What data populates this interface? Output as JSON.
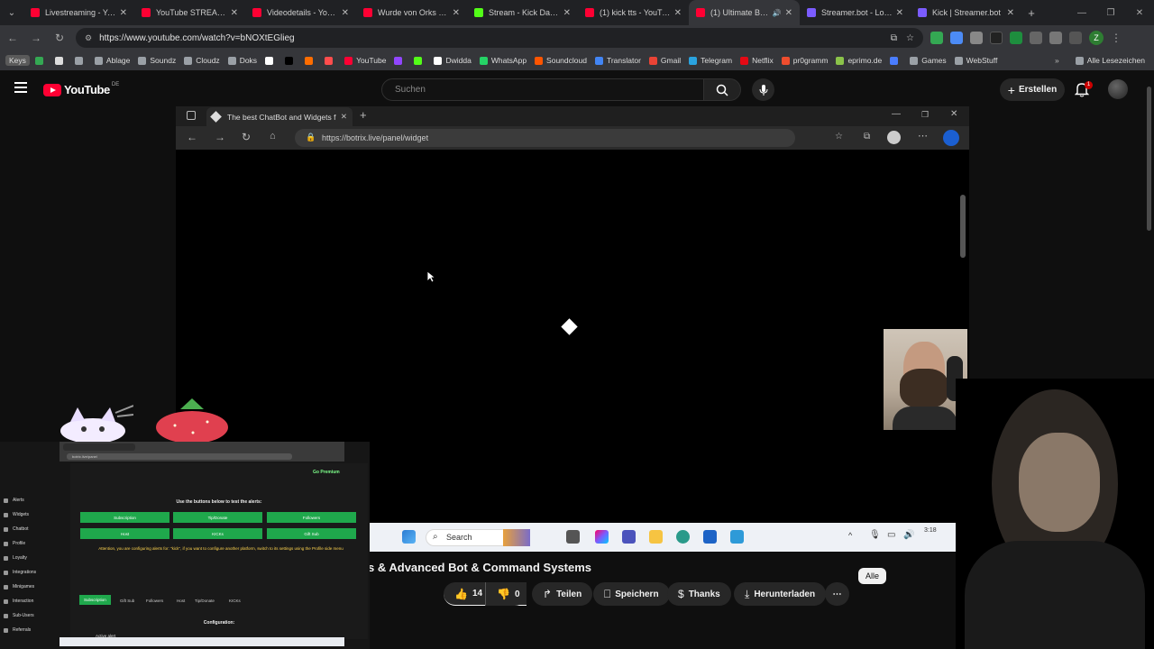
{
  "chrome": {
    "tabs": [
      {
        "title": "Livestreaming - YouT",
        "color": "#ff0033",
        "active": false
      },
      {
        "title": "YouTube STREAM Elh",
        "color": "#ff0033",
        "active": false
      },
      {
        "title": "Videodetails - YouTu",
        "color": "#ff0033",
        "active": false
      },
      {
        "title": "Wurde von Orks aus",
        "color": "#ff0033",
        "active": false
      },
      {
        "title": "Stream - Kick Dashbo",
        "color": "#53fc18",
        "active": false
      },
      {
        "title": "(1) kick tts - YouTube",
        "color": "#ff0033",
        "active": false
      },
      {
        "title": "(1) Ultimate BotR",
        "color": "#ff0033",
        "active": true
      },
      {
        "title": "Streamer.bot - Logge",
        "color": "#7b5cff",
        "active": false
      },
      {
        "title": "Kick | Streamer.bot",
        "color": "#7b5cff",
        "active": false
      }
    ],
    "url": "https://www.youtube.com/watch?v=bNOXtEGlieg",
    "bookmarks": [
      {
        "label": "Ablage",
        "color": "#9aa0a6"
      },
      {
        "label": "Soundz",
        "color": "#9aa0a6"
      },
      {
        "label": "Cloudz",
        "color": "#9aa0a6"
      },
      {
        "label": "Doks",
        "color": "#9aa0a6"
      },
      {
        "label": "",
        "color": "#ffffff"
      },
      {
        "label": "",
        "color": "#000000"
      },
      {
        "label": "",
        "color": "#ff6d00"
      },
      {
        "label": "",
        "color": "#ff4d4d"
      },
      {
        "label": "YouTube",
        "color": "#ff0033"
      },
      {
        "label": "",
        "color": "#9146ff"
      },
      {
        "label": "",
        "color": "#53fc18"
      },
      {
        "label": "Dwidda",
        "color": "#ffffff"
      },
      {
        "label": "WhatsApp",
        "color": "#25d366"
      },
      {
        "label": "Soundcloud",
        "color": "#ff5500"
      },
      {
        "label": "Translator",
        "color": "#4285f4"
      },
      {
        "label": "Gmail",
        "color": "#ea4335"
      },
      {
        "label": "Telegram",
        "color": "#2aa3df"
      },
      {
        "label": "Netflix",
        "color": "#e50914"
      },
      {
        "label": "pr0gramm",
        "color": "#ee4d2e"
      },
      {
        "label": "eprimo.de",
        "color": "#8bc34a"
      },
      {
        "label": "",
        "color": "#4a7dff"
      },
      {
        "label": "Games",
        "color": "#9aa0a6"
      },
      {
        "label": "WebStuff",
        "color": "#9aa0a6"
      }
    ],
    "keys_label": "Keys",
    "all_bookmarks": "Alle Lesezeichen",
    "profile_letter": "Z"
  },
  "youtube": {
    "logo_text": "YouTube",
    "region": "DE",
    "search_placeholder": "Suchen",
    "create_label": "Erstellen",
    "notif_count": "1",
    "video_title": "s & Advanced Bot & Command Systems",
    "likes": "14",
    "dislikes": "0",
    "share_label": "Teilen",
    "save_label": "Speichern",
    "thanks_label": "Thanks",
    "download_label": "Herunterladen",
    "filter_chip": "Alle"
  },
  "edge": {
    "tab_title": "The best ChatBot and Widgets f",
    "url": "https://botrix.live/panel/widget"
  },
  "taskbar": {
    "search_label": "Search",
    "clock": "3:18"
  },
  "mini_panel": {
    "url": "botrix.live/panel",
    "premium": "Go Premium",
    "heading": "Use the buttons below to test the alerts:",
    "buttons": [
      "Subscription",
      "Tip/Donate",
      "Followers",
      "Host",
      "KICKs",
      "Gift Sub"
    ],
    "warning": "Attention, you are configuring alerts for: \"kick\", if you want to configure another platform, switch to its settings using the Profile side menu",
    "tabs": [
      "Subscription",
      "Gift Sub",
      "Followers",
      "Host",
      "Tip/Donate",
      "KICKs"
    ],
    "config_label": "Configuration:",
    "active_alert": "Active alert",
    "sidebar": [
      "Alerts",
      "Widgets",
      "Chatbot",
      "Profile",
      "Loyalty",
      "Integrations",
      "Minigames",
      "Interaction",
      "Sub-Users",
      "Referrals"
    ]
  }
}
